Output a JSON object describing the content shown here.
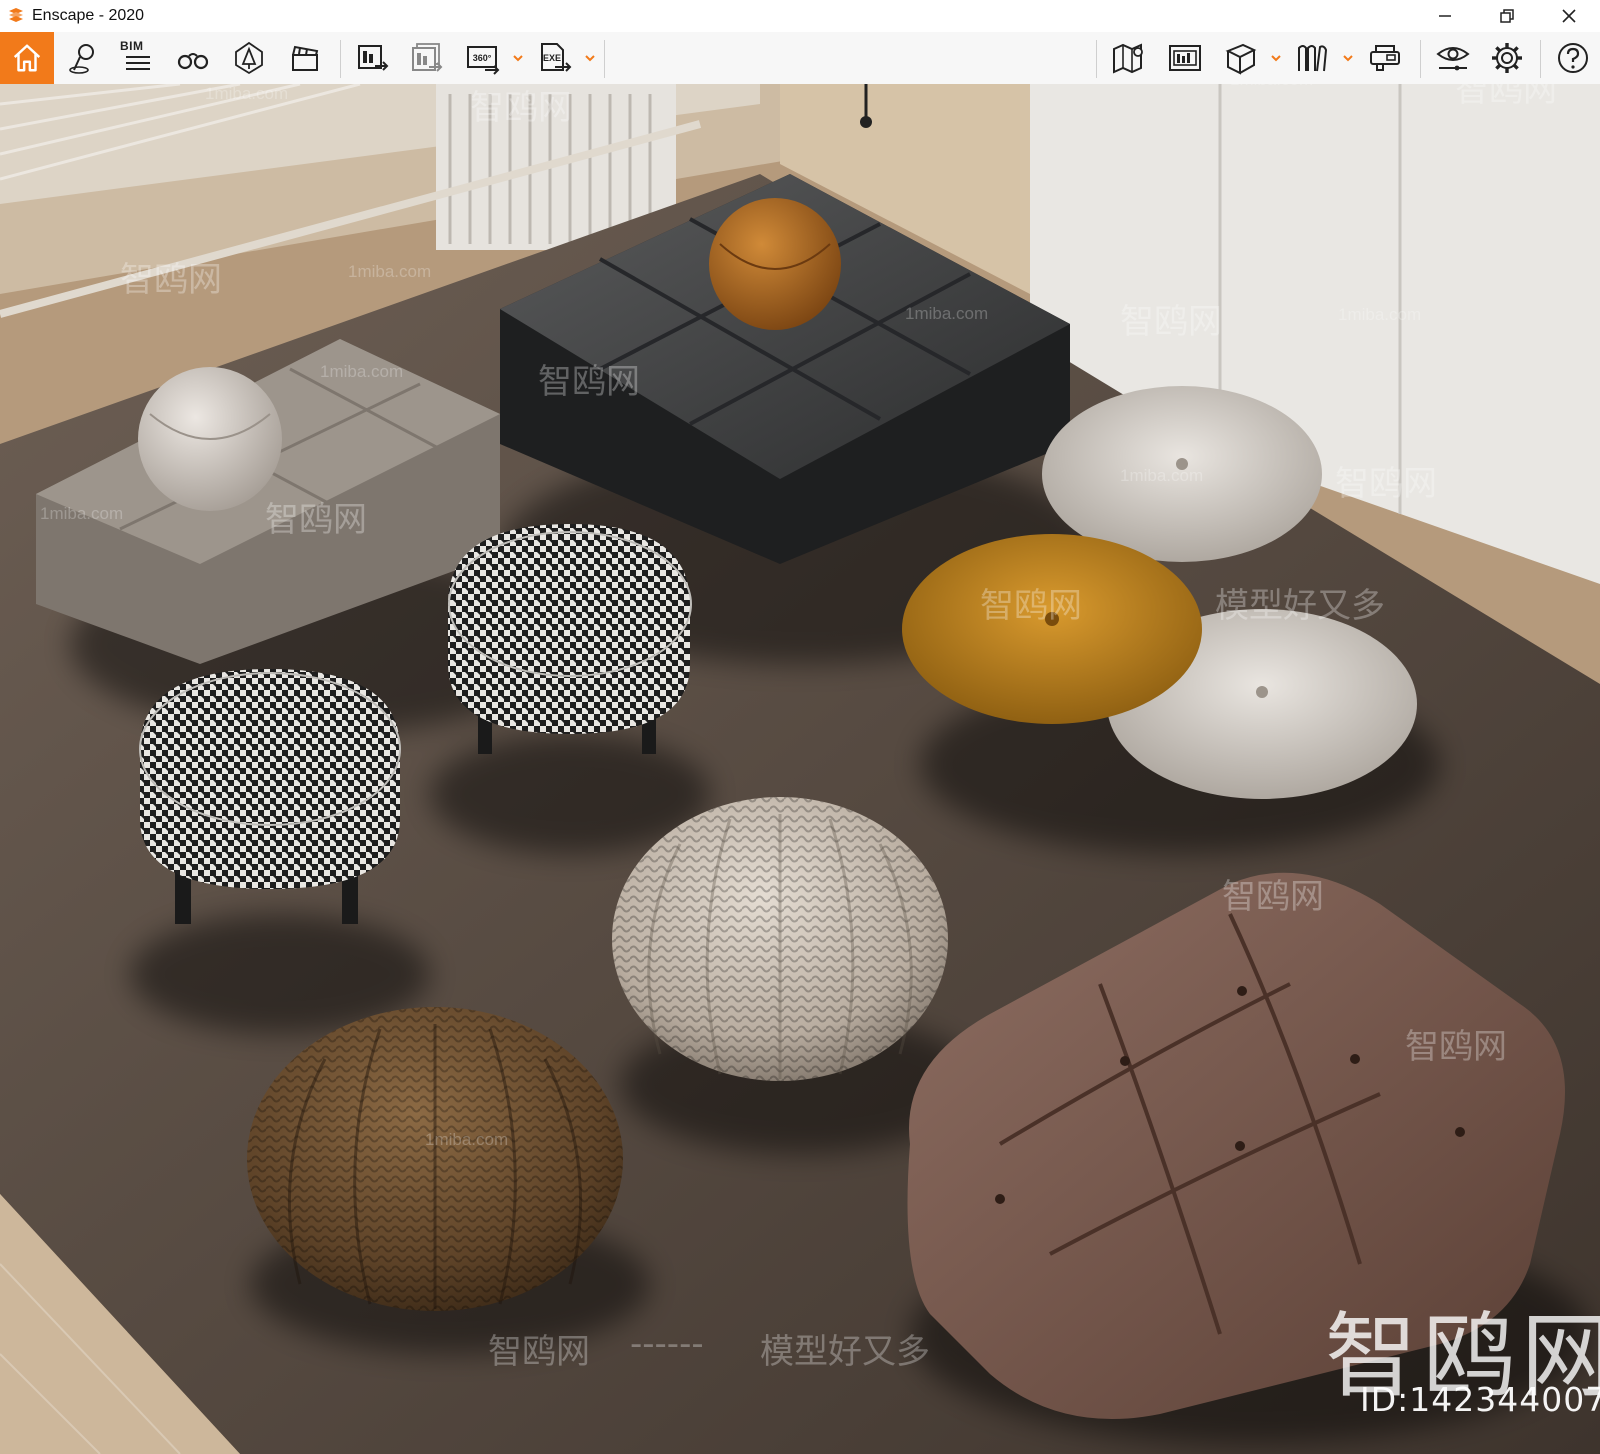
{
  "window": {
    "title": "Enscape - 2020",
    "controls": [
      "minimize-icon",
      "restore-icon",
      "close-icon"
    ]
  },
  "toolbar": {
    "accent_color": "#f27a1a",
    "left_tools": [
      {
        "name": "home-icon",
        "active": true
      },
      {
        "name": "map-pin-icon"
      },
      {
        "name": "bim-icon",
        "label": "BIM"
      },
      {
        "name": "binoculars-icon"
      },
      {
        "name": "lamp-icon"
      },
      {
        "name": "clapperboard-icon"
      },
      {
        "name": "screenshot-export-icon"
      },
      {
        "name": "batch-export-icon"
      },
      {
        "name": "panorama-360-icon",
        "label": "360°",
        "has_dropdown": true
      },
      {
        "name": "exe-export-icon",
        "label": "EXE",
        "has_dropdown": true
      }
    ],
    "right_tools": [
      {
        "name": "map-view-icon"
      },
      {
        "name": "asset-library-icon"
      },
      {
        "name": "cube-view-icon",
        "has_dropdown": true
      },
      {
        "name": "books-icon",
        "has_dropdown": true
      },
      {
        "name": "vr-headset-icon"
      },
      {
        "name": "visibility-icon"
      },
      {
        "name": "settings-gear-icon"
      },
      {
        "name": "help-icon"
      }
    ]
  },
  "scene": {
    "watermarks": {
      "site_name": "智鸥网",
      "site_url": "1miba.com",
      "slogan": "模型好又多",
      "dashes": "------",
      "big_logo": "智鸥网",
      "id_text": "ID:142344007"
    }
  }
}
